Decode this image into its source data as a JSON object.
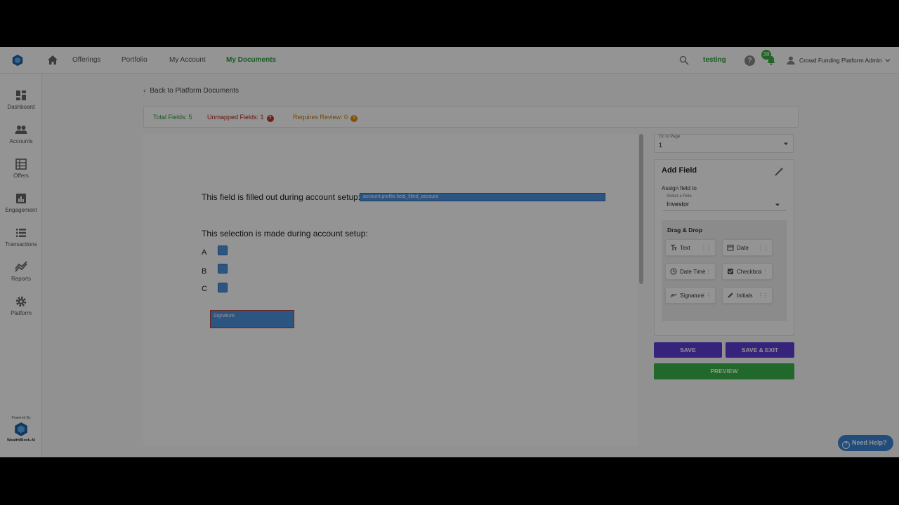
{
  "nav": {
    "links": [
      "Offerings",
      "Portfolio",
      "My Account",
      "My Documents"
    ],
    "active": "My Documents",
    "user_tag": "testing",
    "notif_count": "38",
    "admin_name": "Crowd Funding Platform Admin"
  },
  "sidebar": {
    "items": [
      {
        "label": "Dashboard",
        "icon": "dashboard-icon"
      },
      {
        "label": "Accounts",
        "icon": "accounts-icon"
      },
      {
        "label": "Offers",
        "icon": "offers-icon"
      },
      {
        "label": "Engagement",
        "icon": "engagement-icon"
      },
      {
        "label": "Transactions",
        "icon": "transactions-icon"
      },
      {
        "label": "Reports",
        "icon": "reports-icon"
      },
      {
        "label": "Platform",
        "icon": "gear-icon"
      }
    ],
    "powered_by": "Powered By",
    "brand": "WealthBlock.AI"
  },
  "content": {
    "back_label": "Back to Platform Documents",
    "stats": {
      "total": "Total Fields: 5",
      "unmapped": "Unmapped Fields: 1",
      "review": "Requires Review: 0"
    }
  },
  "document": {
    "line1": "This field is filled out during account setup:",
    "field1_text": "account.profile.field_filled_account",
    "line2": "This selection is made during account setup:",
    "options": [
      "A",
      "B",
      "C"
    ],
    "signature_text": "Signature"
  },
  "panel": {
    "goto_label": "Go to Page",
    "goto_value": "1",
    "add_field_title": "Add Field",
    "assign_label": "Assign field to",
    "role_label": "Select a Role",
    "role_value": "Investor",
    "dnd_title": "Drag & Drop",
    "chips": [
      {
        "label": "Text",
        "icon": "text-icon"
      },
      {
        "label": "Date",
        "icon": "calendar-icon"
      },
      {
        "label": "Date Time",
        "icon": "clock-icon"
      },
      {
        "label": "Checkbox",
        "icon": "checkbox-icon"
      },
      {
        "label": "Signature",
        "icon": "signature-icon"
      },
      {
        "label": "Initials",
        "icon": "pen-icon"
      }
    ],
    "save_label": "SAVE",
    "save_exit_label": "SAVE & EXIT",
    "preview_label": "PREVIEW"
  },
  "help": {
    "label": "Need Help?"
  },
  "colors": {
    "accent_green": "#2e9d3a",
    "primary_purple": "#5e3fd6",
    "field_blue": "#4e93df",
    "error_red": "#c0392b"
  }
}
